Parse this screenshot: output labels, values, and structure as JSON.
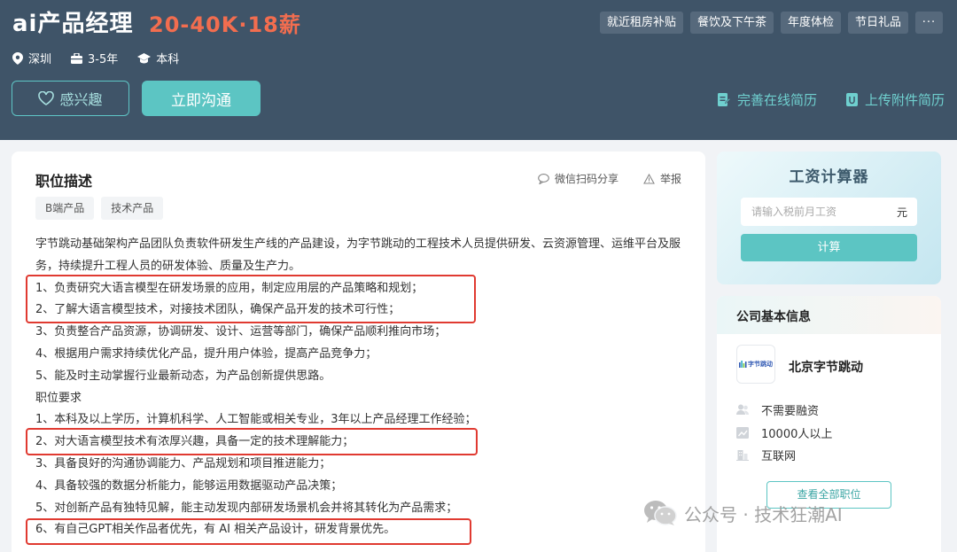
{
  "header": {
    "job_title": "ai产品经理",
    "salary": "20-40K·18薪",
    "benefits": [
      "就近租房补贴",
      "餐饮及下午茶",
      "年度体检",
      "节日礼品",
      "···"
    ],
    "location": "深圳",
    "experience": "3-5年",
    "education": "本科",
    "interest_label": "感兴趣",
    "chat_label": "立即沟通",
    "resume_online_label": "完善在线简历",
    "resume_upload_label": "上传附件简历"
  },
  "job": {
    "section_title": "职位描述",
    "share_label": "微信扫码分享",
    "report_label": "举报",
    "tags": [
      "B端产品",
      "技术产品"
    ],
    "description": [
      "字节跳动基础架构产品团队负责软件研发生产线的产品建设，为字节跳动的工程技术人员提供研发、云资源管理、运维平台及服务，持续提升工程人员的研发体验、质量及生产力。",
      "1、负责研究大语言模型在研发场景的应用，制定应用层的产品策略和规划；",
      "2、了解大语言模型技术，对接技术团队，确保产品开发的技术可行性；",
      "3、负责整合产品资源，协调研发、设计、运营等部门，确保产品顺利推向市场；",
      "4、根据用户需求持续优化产品，提升用户体验，提高产品竞争力；",
      "5、能及时主动掌握行业最新动态，为产品创新提供思路。",
      "职位要求",
      "1、本科及以上学历，计算机科学、人工智能或相关专业，3年以上产品经理工作经验；",
      "2、对大语言模型技术有浓厚兴趣，具备一定的技术理解能力；",
      "3、具备良好的沟通协调能力、产品规划和项目推进能力；",
      "4、具备较强的数据分析能力，能够运用数据驱动产品决策；",
      "5、对创新产品有独特见解，能主动发现内部研发场景机会并将其转化为产品需求；",
      "6、有自己GPT相关作品者优先，有 AI 相关产品设计，研发背景优先。"
    ]
  },
  "calculator": {
    "title": "工资计算器",
    "placeholder": "请输入税前月工资",
    "unit": "元",
    "button_label": "计算"
  },
  "company": {
    "section_title": "公司基本信息",
    "logo_text": "字节跳动",
    "name": "北京字节跳动",
    "financing": "不需要融资",
    "size": "10000人以上",
    "industry": "互联网",
    "all_jobs_label": "查看全部职位"
  },
  "watermark": "公众号 · 技术狂潮AI",
  "colors": {
    "header_bg": "#3f5468",
    "accent": "#5cc5c3",
    "salary": "#f26d4f",
    "highlight": "#e03a31"
  }
}
